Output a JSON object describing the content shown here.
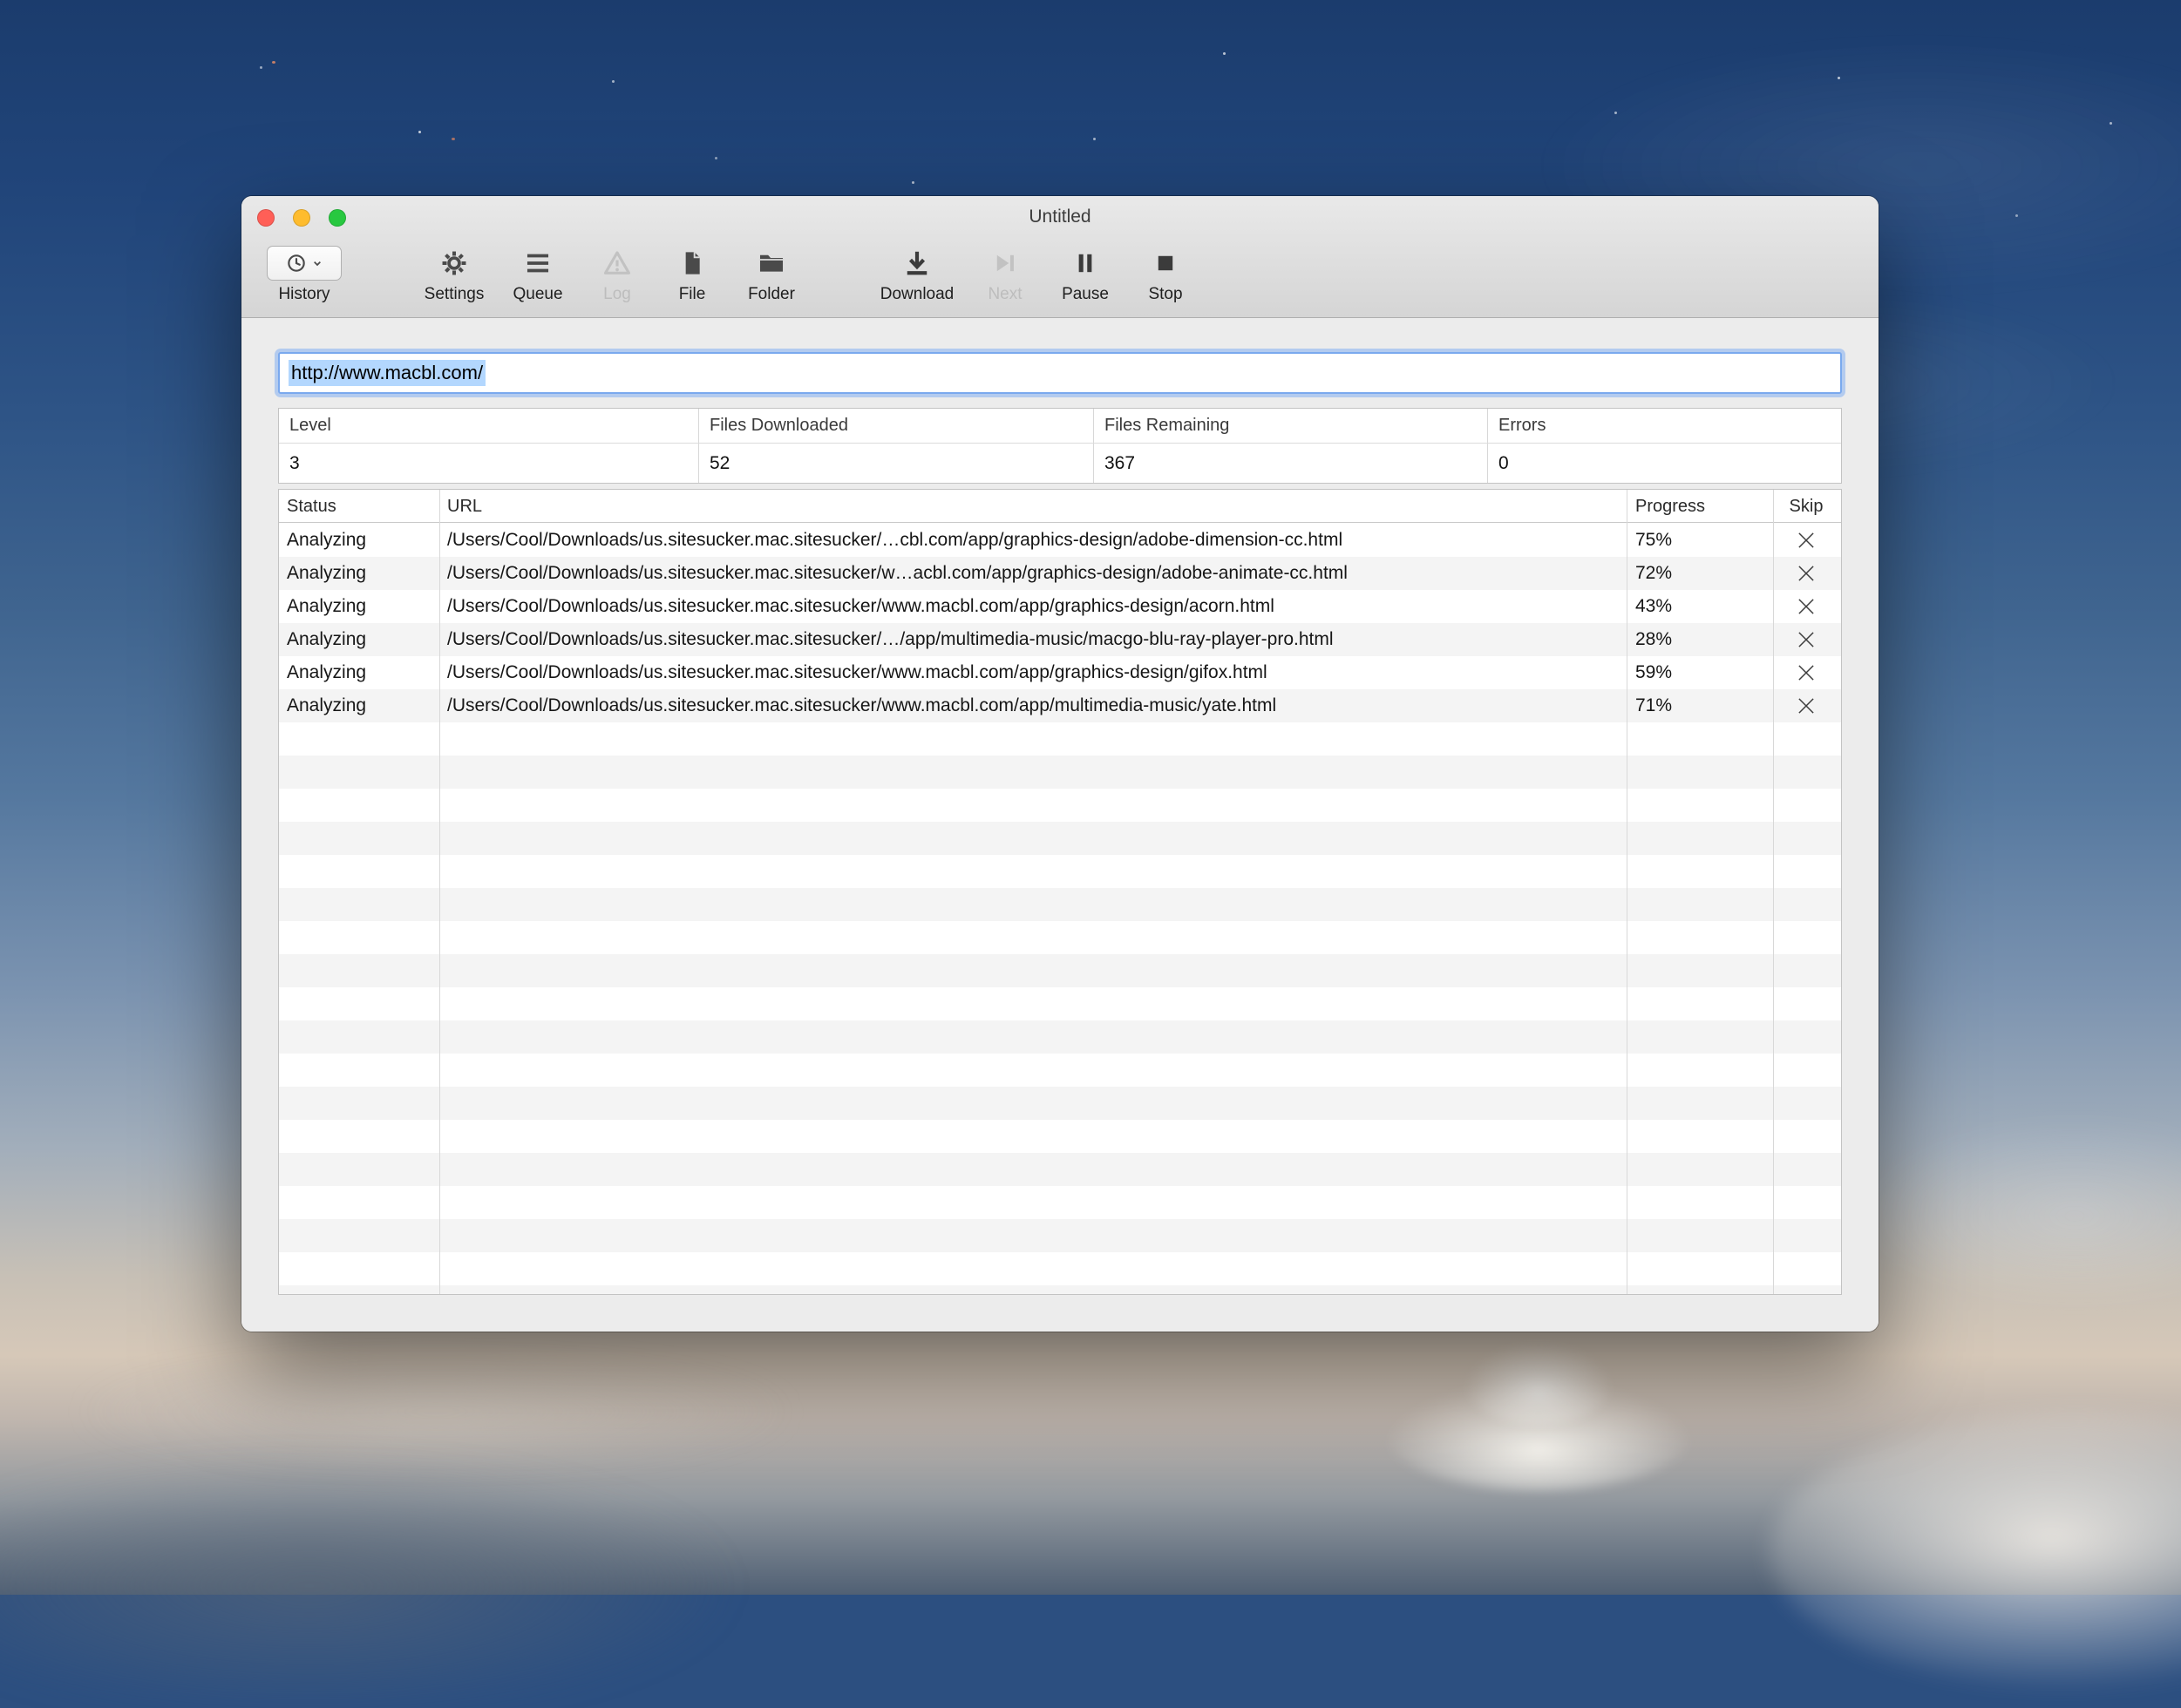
{
  "colors": {
    "traffic_red": "#ff5f57",
    "traffic_yellow": "#febc2e",
    "traffic_green": "#28c840",
    "text_selection": "#b3d7fe",
    "focus_ring": "#7aa9ee"
  },
  "window": {
    "title": "Untitled",
    "toolbar": {
      "history_label": "History",
      "buttons": [
        {
          "label": "Settings",
          "icon": "gear-icon",
          "enabled": true
        },
        {
          "label": "Queue",
          "icon": "list-icon",
          "enabled": true
        },
        {
          "label": "Log",
          "icon": "warning-icon",
          "enabled": false
        },
        {
          "label": "File",
          "icon": "file-icon",
          "enabled": true
        },
        {
          "label": "Folder",
          "icon": "folder-icon",
          "enabled": true
        },
        {
          "label": "Download",
          "icon": "download-icon",
          "enabled": true
        },
        {
          "label": "Next",
          "icon": "skip-next-icon",
          "enabled": false
        },
        {
          "label": "Pause",
          "icon": "pause-icon",
          "enabled": true
        },
        {
          "label": "Stop",
          "icon": "stop-icon",
          "enabled": true
        }
      ]
    },
    "url_input": {
      "value": "http://www.macbl.com/"
    },
    "stats": {
      "headers": [
        "Level",
        "Files Downloaded",
        "Files Remaining",
        "Errors"
      ],
      "values": [
        "3",
        "52",
        "367",
        "0"
      ]
    },
    "queue_table": {
      "headers": [
        "Status",
        "URL",
        "Progress",
        "Skip"
      ],
      "rows": [
        {
          "status": "Analyzing",
          "url": "/Users/Cool/Downloads/us.sitesucker.mac.sitesucker/…cbl.com/app/graphics-design/adobe-dimension-cc.html",
          "progress": "75%"
        },
        {
          "status": "Analyzing",
          "url": "/Users/Cool/Downloads/us.sitesucker.mac.sitesucker/w…acbl.com/app/graphics-design/adobe-animate-cc.html",
          "progress": "72%"
        },
        {
          "status": "Analyzing",
          "url": "/Users/Cool/Downloads/us.sitesucker.mac.sitesucker/www.macbl.com/app/graphics-design/acorn.html",
          "progress": "43%"
        },
        {
          "status": "Analyzing",
          "url": "/Users/Cool/Downloads/us.sitesucker.mac.sitesucker/…/app/multimedia-music/macgo-blu-ray-player-pro.html",
          "progress": "28%"
        },
        {
          "status": "Analyzing",
          "url": "/Users/Cool/Downloads/us.sitesucker.mac.sitesucker/www.macbl.com/app/graphics-design/gifox.html",
          "progress": "59%"
        },
        {
          "status": "Analyzing",
          "url": "/Users/Cool/Downloads/us.sitesucker.mac.sitesucker/www.macbl.com/app/multimedia-music/yate.html",
          "progress": "71%"
        }
      ]
    }
  }
}
